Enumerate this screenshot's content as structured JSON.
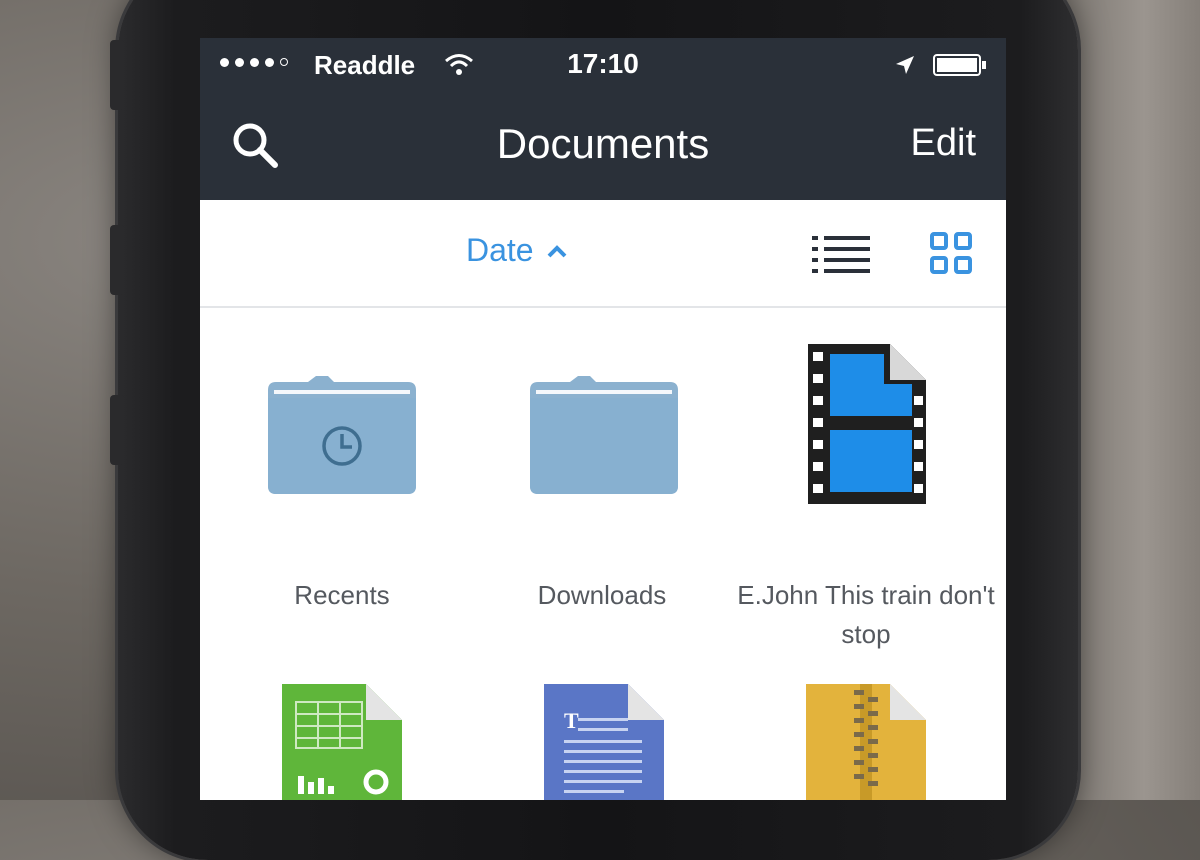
{
  "status_bar": {
    "carrier": "Readdle",
    "time": "17:10"
  },
  "nav": {
    "title": "Documents",
    "edit_label": "Edit"
  },
  "toolbar": {
    "sort_label": "Date"
  },
  "items": [
    {
      "label": "Recents",
      "icon": "clock-folder-icon"
    },
    {
      "label": "Downloads",
      "icon": "folder-icon"
    },
    {
      "label": "E.John This train don't stop",
      "icon": "video-file-icon"
    },
    {
      "label": "",
      "icon": "spreadsheet-file-icon"
    },
    {
      "label": "",
      "icon": "text-document-icon"
    },
    {
      "label": "",
      "icon": "zip-archive-icon"
    }
  ],
  "colors": {
    "nav_bg": "#2a3039",
    "accent": "#3a93e0",
    "folder": "#8bb1cf"
  }
}
